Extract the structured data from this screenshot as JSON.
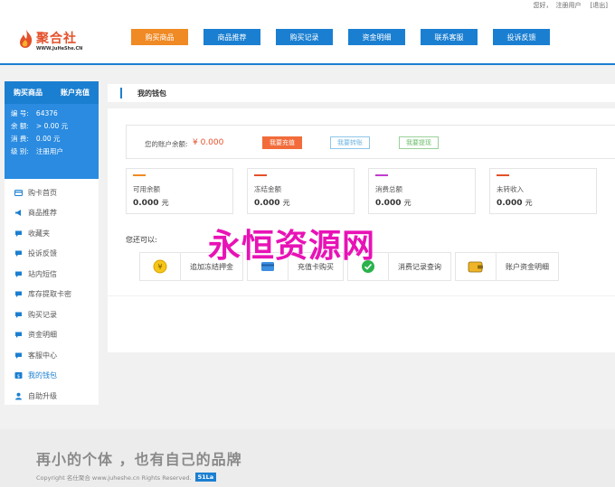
{
  "topbar": {
    "greeting": "您好，",
    "user": "注册用户",
    "logout": "[退出]"
  },
  "logo": {
    "name": "聚合社",
    "domain": "WWW.JuHeShe.CN"
  },
  "nav": [
    {
      "label": "购买商品",
      "active": true
    },
    {
      "label": "商品推荐",
      "active": false
    },
    {
      "label": "购买记录",
      "active": false
    },
    {
      "label": "资金明细",
      "active": false
    },
    {
      "label": "联系客服",
      "active": false
    },
    {
      "label": "投诉反馈",
      "active": false
    }
  ],
  "sidebar": {
    "tabs": [
      "购买商品",
      "账户充值"
    ],
    "user": [
      {
        "label": "编  号:",
        "value": "64376"
      },
      {
        "label": "余  额:",
        "value": "> 0.00 元"
      },
      {
        "label": "消  费:",
        "value": "0.00 元"
      },
      {
        "label": "级  别:",
        "value": "注册用户"
      }
    ],
    "menu": [
      {
        "label": "购卡首页",
        "icon": "card-icon"
      },
      {
        "label": "商品推荐",
        "icon": "megaphone-icon"
      },
      {
        "label": "收藏夹",
        "icon": "chat-icon"
      },
      {
        "label": "投诉反馈",
        "icon": "chat-icon"
      },
      {
        "label": "站内短信",
        "icon": "chat-icon"
      },
      {
        "label": "库存提取卡密",
        "icon": "chat-icon"
      },
      {
        "label": "购买记录",
        "icon": "chat-icon"
      },
      {
        "label": "资金明细",
        "icon": "chat-icon"
      },
      {
        "label": "客服中心",
        "icon": "chat-icon"
      },
      {
        "label": "我的钱包",
        "icon": "wallet-icon"
      },
      {
        "label": "自助升级",
        "icon": "user-icon"
      }
    ]
  },
  "main": {
    "title": "我的钱包",
    "balance_label": "您的账户余额:",
    "balance_value": "¥ 0.000",
    "buttons": {
      "recharge": "我要充值",
      "transfer": "我要转账",
      "withdraw": "我要提现"
    },
    "stats": [
      {
        "label": "可用余额",
        "value": "0.000",
        "unit": "元",
        "color": "#f08a24"
      },
      {
        "label": "冻结金额",
        "value": "0.000",
        "unit": "元",
        "color": "#e4502a"
      },
      {
        "label": "消费总额",
        "value": "0.000",
        "unit": "元",
        "color": "#c23bcf"
      },
      {
        "label": "未转收入",
        "value": "0.000",
        "unit": "元",
        "color": "#e4502a"
      }
    ],
    "cando": "您还可以:",
    "actions": [
      {
        "label": "追加冻结押金",
        "icon": "coin-icon"
      },
      {
        "label": "充值卡购买",
        "icon": "card-icon"
      },
      {
        "label": "消费记录查询",
        "icon": "check-icon"
      },
      {
        "label": "账户资金明细",
        "icon": "wallet-icon"
      }
    ]
  },
  "watermark": "永恒资源网",
  "footer": {
    "slogan": "再小的个体 ，也有自己的品牌",
    "copyright": "Copyright 名仕聚合 www.juheshe.cn Rights Reserved.",
    "badge": "51La"
  }
}
